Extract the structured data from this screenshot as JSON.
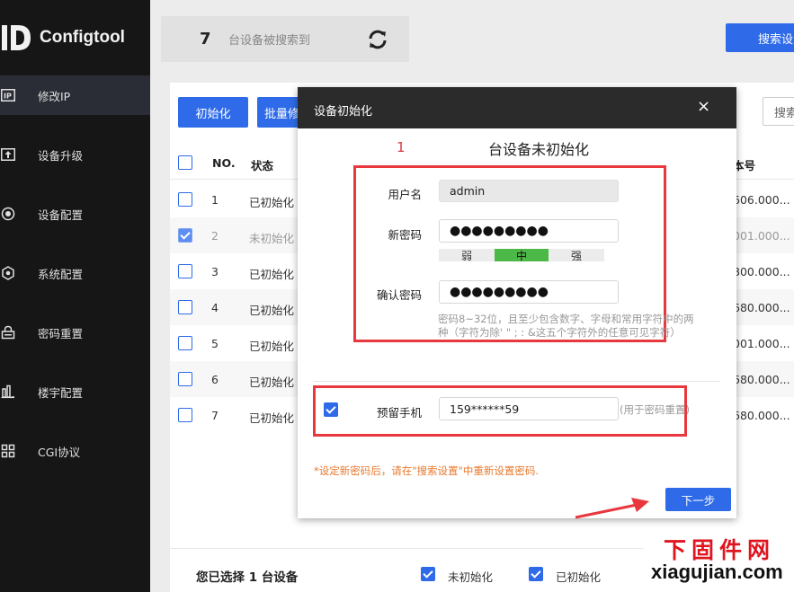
{
  "app": {
    "name": "Configtool"
  },
  "sidebar": {
    "items": [
      {
        "label": "修改IP",
        "icon": "ip-icon",
        "active": true
      },
      {
        "label": "设备升级",
        "icon": "upgrade-icon",
        "active": false
      },
      {
        "label": "设备配置",
        "icon": "device-config-icon",
        "active": false
      },
      {
        "label": "系统配置",
        "icon": "system-config-icon",
        "active": false
      },
      {
        "label": "密码重置",
        "icon": "password-reset-icon",
        "active": false
      },
      {
        "label": "楼宇配置",
        "icon": "building-icon",
        "active": false
      },
      {
        "label": "CGI协议",
        "icon": "cgi-icon",
        "active": false
      }
    ]
  },
  "search_summary": {
    "count": "7",
    "text": "台设备被搜索到"
  },
  "toolbar": {
    "search_settings": "搜索设置",
    "init": "初始化",
    "batch_modify": "批量修",
    "search_input": "搜索"
  },
  "table": {
    "headers": {
      "no": "NO.",
      "status": "状态",
      "version": "本号"
    },
    "rows": [
      {
        "no": "1",
        "status": "已初始化",
        "version": "606.000...",
        "checked": false
      },
      {
        "no": "2",
        "status": "未初始化",
        "version": "001.000...",
        "checked": true
      },
      {
        "no": "3",
        "status": "已初始化",
        "version": "800.000...",
        "checked": false
      },
      {
        "no": "4",
        "status": "已初始化",
        "version": "680.000...",
        "checked": false
      },
      {
        "no": "5",
        "status": "已初始化",
        "version": "001.000...",
        "checked": false
      },
      {
        "no": "6",
        "status": "已初始化",
        "version": "680.000...",
        "checked": false
      },
      {
        "no": "7",
        "status": "已初始化",
        "version": "680.000...",
        "checked": false
      }
    ]
  },
  "bottom": {
    "selected": "您已选择 1 台设备",
    "uninit_label": "未初始化",
    "init_label": "已初始化"
  },
  "modal": {
    "title": "设备初始化",
    "close": "×",
    "uninit_count": "1",
    "uninit_text": "台设备未初始化",
    "username_label": "用户名",
    "username_value": "admin",
    "new_password_label": "新密码",
    "new_password_value": "●●●●●●●●●",
    "strength": {
      "weak": "弱",
      "medium": "中",
      "strong": "强"
    },
    "confirm_password_label": "确认密码",
    "confirm_password_value": "●●●●●●●●●",
    "hint_line1": "密码8~32位，且至少包含数字、字母和常用字符中的两",
    "hint_line2": "种（字符为除' \" ; : &这五个字符外的任意可见字符）",
    "phone_label": "预留手机",
    "phone_value": "159******59",
    "phone_hint": "(用于密码重置)",
    "warning": "*设定新密码后，请在\"搜索设置\"中重新设置密码.",
    "next": "下一步"
  },
  "watermark": {
    "cn": "下固件网",
    "en": "xiagujian.com"
  },
  "colors": {
    "primary": "#2f6be8",
    "sidebar": "#161616",
    "highlight": "#e8383d",
    "strength_medium": "#4cb847"
  }
}
